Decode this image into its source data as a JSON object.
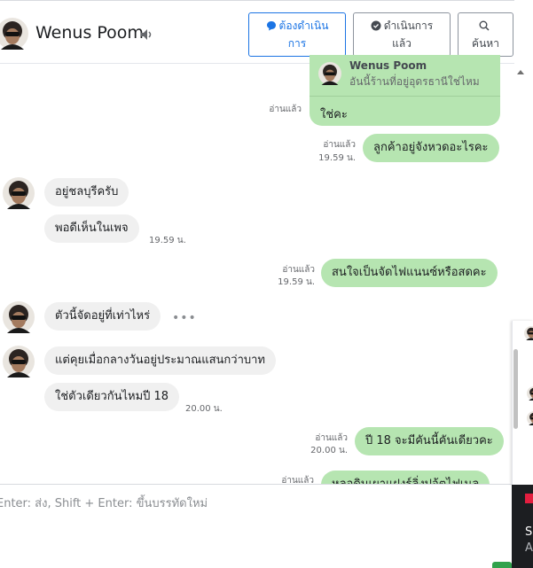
{
  "header": {
    "contact_name": "Wenus Poom",
    "buttons": {
      "follow_up": {
        "line1": "ต้องดำเนิน",
        "line2": "การ"
      },
      "done": {
        "line1": "ดำเนินการ",
        "line2": "แล้ว"
      },
      "search": {
        "line2": "ค้นหา"
      }
    }
  },
  "quote": {
    "name": "Wenus Poom",
    "text": "อันนี้ร้านที่อยู่อุดรธานีใช่ไหม",
    "reply": "ใช่คะ",
    "read": "อ่านแล้ว"
  },
  "messages": [
    {
      "side": "out",
      "text": "ลูกค้าอยู่จังหวดอะไรคะ",
      "read": "อ่านแล้ว",
      "time": "19.59 น."
    },
    {
      "side": "in",
      "text": "อยู่ชลบุรีครับ"
    },
    {
      "side": "in",
      "text": "พอดีเห็นในเพจ",
      "time": "19.59 น."
    },
    {
      "side": "out",
      "text": "สนใจเป็นจัดไฟแนนซ์หรือสดคะ",
      "read": "อ่านแล้ว",
      "time": "19.59 น."
    },
    {
      "side": "in",
      "text": "ตัวนี้จัดอยู่ที่เท่าไหร่"
    },
    {
      "side": "in",
      "text": "แต่คุยเมื่อกลางวันอยู่ประมาณแสนกว่าบาท"
    },
    {
      "side": "in",
      "text": "ใช่ตัวเดียวกันไหมปี 18",
      "time": "20.00 น."
    },
    {
      "side": "out",
      "text": "ปี 18 จะมีคันนี้คันเดียวคะ",
      "read": "อ่านแล้ว",
      "time": "20.00 น."
    },
    {
      "side": "out",
      "text": "หลอดินเผาแฝงร์ลิ่งปอ้ตไฟเนล",
      "read": "อ่านแล้ว"
    }
  ],
  "more_dots": "•••",
  "composer": {
    "placeholder": "Enter: ส่ง, Shift + Enter: ขึ้นบรรทัดใหม่"
  },
  "side_panel": {
    "line1": "Se",
    "line2": "A"
  },
  "colors": {
    "outgoing_bubble": "#b6e5b1",
    "incoming_bubble": "#f0f0f0",
    "accent": "#1b74e4"
  }
}
